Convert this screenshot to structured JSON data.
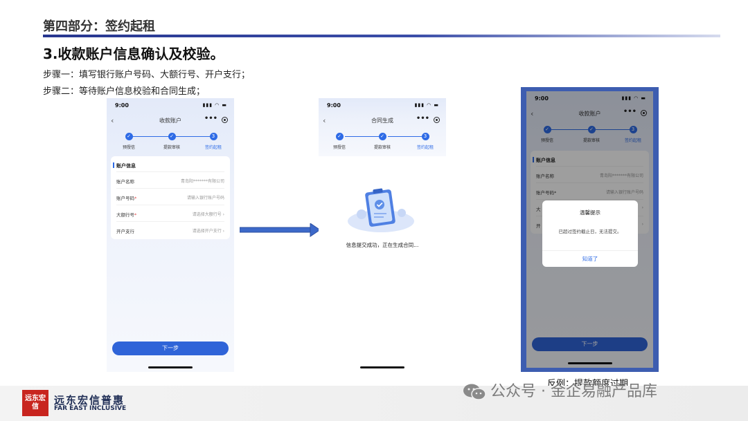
{
  "slide": {
    "section_title": "第四部分：签约起租",
    "heading": "3.收款账户信息确认及校验。",
    "step1": "步骤一：填写银行账户号码、大额行号、开户支行；",
    "step2": "步骤二：等待账户信息校验和合同生成；",
    "caption": "反例：提款额度过期"
  },
  "phone_common": {
    "time": "9:00",
    "steps": [
      {
        "label": "预授信",
        "icon": "✓"
      },
      {
        "label": "提款审核",
        "icon": "✓"
      },
      {
        "label": "签约起租",
        "icon": "3"
      }
    ],
    "next_button": "下一步"
  },
  "phone1": {
    "nav_title": "收款账户",
    "card_title": "账户信息",
    "rows": [
      {
        "key": "账户名称",
        "required": "",
        "value": "青岛阳*******有限公司"
      },
      {
        "key": "账户号码",
        "required": "*",
        "value": "请输入银行账户号码"
      },
      {
        "key": "大额行号",
        "required": "*",
        "value": "请选择大额行号 ›"
      },
      {
        "key": "开户支行",
        "required": "",
        "value": "请选择开户支行 ›"
      }
    ]
  },
  "phone2": {
    "nav_title": "合同生成",
    "status_text": "信息提交成功，正在生成合同..."
  },
  "phone3": {
    "nav_title": "收款账户",
    "card_title": "账户信息",
    "rows": [
      {
        "key": "账户名称",
        "value": "青岛阳*******有限公司"
      },
      {
        "key": "账户号码*",
        "value": "请输入银行账户号码"
      },
      {
        "key": "大",
        "value": "›"
      },
      {
        "key": "开",
        "value": "›"
      }
    ],
    "dialog": {
      "title": "温馨提示",
      "message": "已超过签约截止日，无法提交。",
      "button": "知道了"
    }
  },
  "footer": {
    "logo_text": "远东宏信",
    "brand_cn": "远东宏信普惠",
    "brand_en": "FAR EAST INCLUSIVE",
    "watermark": "公众号 · 金企易融产品库"
  },
  "colors": {
    "accent": "#2e6be6",
    "frame": "#3d5db0",
    "logo_red": "#c8251f"
  }
}
